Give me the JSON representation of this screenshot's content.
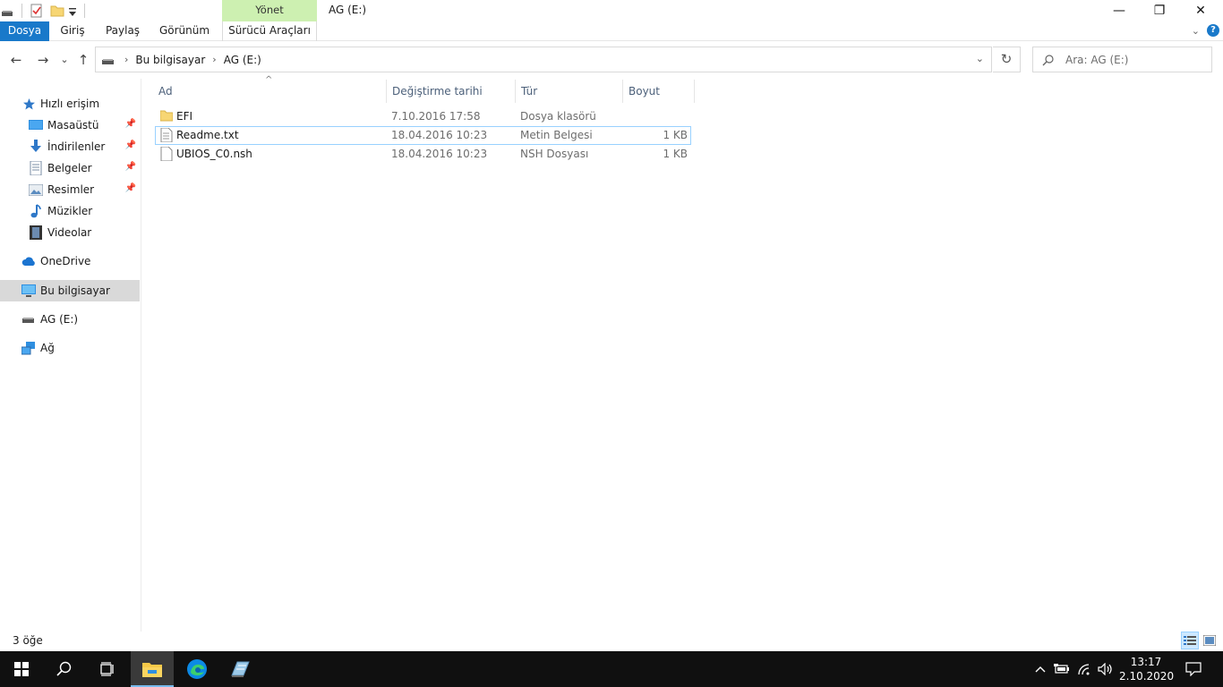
{
  "window": {
    "title": "AG (E:)",
    "manage_tab": "Yönet",
    "minimize": "—",
    "maximize": "❐",
    "close": "✕"
  },
  "ribbon": {
    "tabs": [
      "Dosya",
      "Giriş",
      "Paylaş",
      "Görünüm",
      "Sürücü Araçları"
    ],
    "expand": "⌄",
    "help": "?"
  },
  "nav": {
    "back": "←",
    "forward": "→",
    "recent": "⌄",
    "up": "↑",
    "breadcrumb": [
      "Bu bilgisayar",
      "AG (E:)"
    ],
    "crumb_sep": "›",
    "dropdown": "⌄",
    "refresh": "↻",
    "search_placeholder": "Ara: AG (E:)"
  },
  "sidebar": {
    "items": [
      {
        "label": "Hızlı erişim",
        "icon": "star-icon"
      },
      {
        "label": "Masaüstü",
        "icon": "desktop-icon",
        "pinned": true
      },
      {
        "label": "İndirilenler",
        "icon": "download-icon",
        "pinned": true
      },
      {
        "label": "Belgeler",
        "icon": "documents-icon",
        "pinned": true
      },
      {
        "label": "Resimler",
        "icon": "pictures-icon",
        "pinned": true
      },
      {
        "label": "Müzikler",
        "icon": "music-icon"
      },
      {
        "label": "Videolar",
        "icon": "video-icon"
      },
      {
        "label": "OneDrive",
        "icon": "cloud-icon"
      },
      {
        "label": "Bu bilgisayar",
        "icon": "computer-icon",
        "selected": true
      },
      {
        "label": "AG (E:)",
        "icon": "drive-icon"
      },
      {
        "label": "Ağ",
        "icon": "network-icon"
      }
    ]
  },
  "columns": {
    "name": "Ad",
    "date": "Değiştirme tarihi",
    "type": "Tür",
    "size": "Boyut"
  },
  "files": [
    {
      "name": "EFI",
      "date": "7.10.2016 17:58",
      "type": "Dosya klasörü",
      "size": "",
      "icon": "folder-icon"
    },
    {
      "name": "Readme.txt",
      "date": "18.04.2016 10:23",
      "type": "Metin Belgesi",
      "size": "1 KB",
      "icon": "text-file-icon"
    },
    {
      "name": "UBIOS_C0.nsh",
      "date": "18.04.2016 10:23",
      "type": "NSH Dosyası",
      "size": "1 KB",
      "icon": "file-icon"
    }
  ],
  "status": {
    "item_count": "3 öğe"
  },
  "taskbar": {
    "time": "13:17",
    "date": "2.10.2020"
  },
  "colors": {
    "accent": "#1979ca",
    "manage_tab": "#cdf0b1",
    "taskbar": "#101010"
  }
}
